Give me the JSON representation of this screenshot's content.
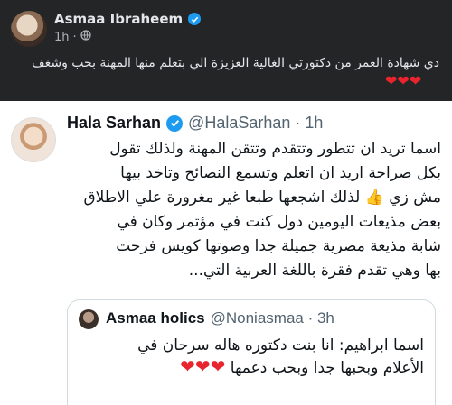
{
  "post": {
    "author": "Asmaa Ibraheem",
    "time": "1h",
    "text": "دي شهادة العمر من دكتورتي الغالية العزيزة الي بتعلم منها المهنة بحب وشغف",
    "hearts": "❤❤❤"
  },
  "tweet": {
    "name": "Hala Sarhan",
    "handle": "@HalaSarhan · 1h",
    "lines": [
      "اسما تريد ان تتطور وتتقدم وتتقن المهنة ولذلك تقول",
      "بكل صراحة اريد ان اتعلم وتسمع النصائح وتاخد بيها",
      "لذلك اشجعها طبعا غير مغرورة علي الاطلاق",
      "مش زي",
      "بعض مذيعات اليومين دول كنت في مؤتمر وكان في",
      "شابة مذيعة مصرية جميلة جدا وصوتها كويس فرحت",
      "بها وهي تقدم  فقرة باللغة العربية التي..."
    ],
    "thumb": "👍"
  },
  "quote": {
    "name": "Asmaa holics",
    "handle": "@Noniasmaa · 3h",
    "lines": [
      "اسما ابراهيم: انا بنت دكتوره هاله سرحان في",
      "الأعلام وبحبها جدا وبحب دعمها"
    ],
    "hearts": "❤❤❤"
  }
}
